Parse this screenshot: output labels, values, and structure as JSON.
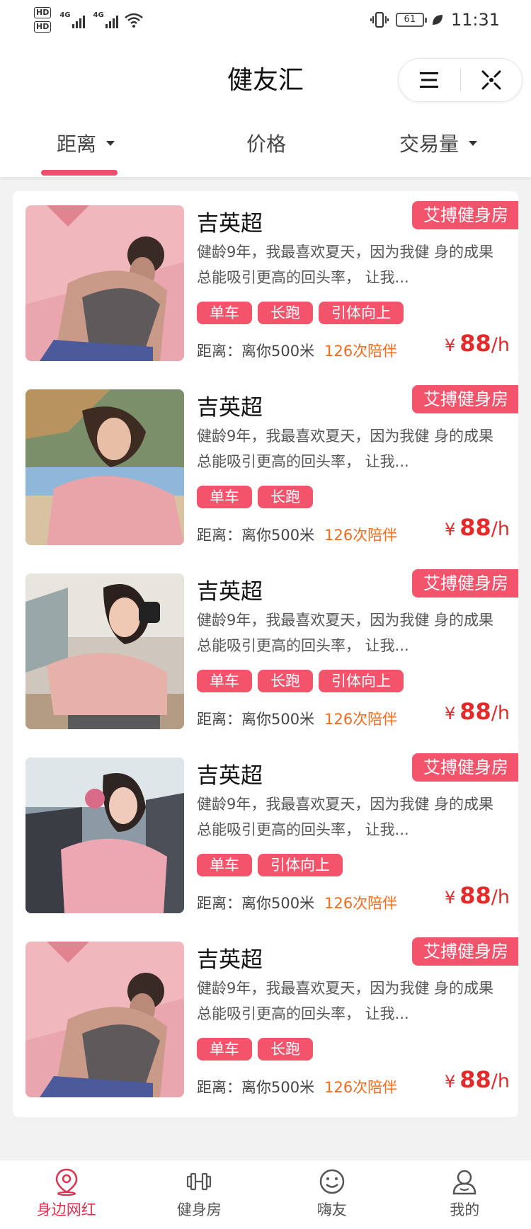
{
  "status_bar": {
    "time": "11:31",
    "battery": "61",
    "hd1": "HD",
    "hd2": "HD",
    "net1": "4G",
    "net2": "4G"
  },
  "app": {
    "title": "健友汇",
    "menu_icon": "menu-icon",
    "close_icon": "close-target-icon"
  },
  "filters": [
    {
      "label": "距离",
      "caret": true,
      "active": true
    },
    {
      "label": "价格",
      "caret": false,
      "active": false
    },
    {
      "label": "交易量",
      "caret": true,
      "active": false
    }
  ],
  "cards": [
    {
      "name": "吉英超",
      "gym": "艾搏健身房",
      "desc": "健龄9年，我最喜欢夏天，因为我健 身的成果总能吸引更高的回头率， 让我...",
      "tags": [
        "单车",
        "长跑",
        "引体向上"
      ],
      "distance": "距离：离你500米",
      "companions": "126次陪伴",
      "currency": "¥",
      "price": "88",
      "unit": "/h"
    },
    {
      "name": "吉英超",
      "gym": "艾搏健身房",
      "desc": "健龄9年，我最喜欢夏天，因为我健 身的成果总能吸引更高的回头率， 让我...",
      "tags": [
        "单车",
        "长跑"
      ],
      "distance": "距离：离你500米",
      "companions": "126次陪伴",
      "currency": "¥",
      "price": "88",
      "unit": "/h"
    },
    {
      "name": "吉英超",
      "gym": "艾搏健身房",
      "desc": "健龄9年，我最喜欢夏天，因为我健 身的成果总能吸引更高的回头率， 让我...",
      "tags": [
        "单车",
        "长跑",
        "引体向上"
      ],
      "distance": "距离：离你500米",
      "companions": "126次陪伴",
      "currency": "¥",
      "price": "88",
      "unit": "/h"
    },
    {
      "name": "吉英超",
      "gym": "艾搏健身房",
      "desc": "健龄9年，我最喜欢夏天，因为我健 身的成果总能吸引更高的回头率， 让我...",
      "tags": [
        "单车",
        "引体向上"
      ],
      "distance": "距离：离你500米",
      "companions": "126次陪伴",
      "currency": "¥",
      "price": "88",
      "unit": "/h"
    },
    {
      "name": "吉英超",
      "gym": "艾搏健身房",
      "desc": "健龄9年，我最喜欢夏天，因为我健 身的成果总能吸引更高的回头率， 让我...",
      "tags": [
        "单车",
        "长跑"
      ],
      "distance": "距离：离你500米",
      "companions": "126次陪伴",
      "currency": "¥",
      "price": "88",
      "unit": "/h"
    }
  ],
  "tabbar": [
    {
      "label": "身边网红",
      "icon": "location-pin-icon",
      "active": true
    },
    {
      "label": "健身房",
      "icon": "dumbbell-icon",
      "active": false
    },
    {
      "label": "嗨友",
      "icon": "smiley-icon",
      "active": false
    },
    {
      "label": "我的",
      "icon": "person-icon",
      "active": false
    }
  ],
  "colors": {
    "accent": "#f4536c",
    "price": "#e52a2a",
    "companions": "#f26a1b",
    "active_tab": "#e0304e"
  }
}
